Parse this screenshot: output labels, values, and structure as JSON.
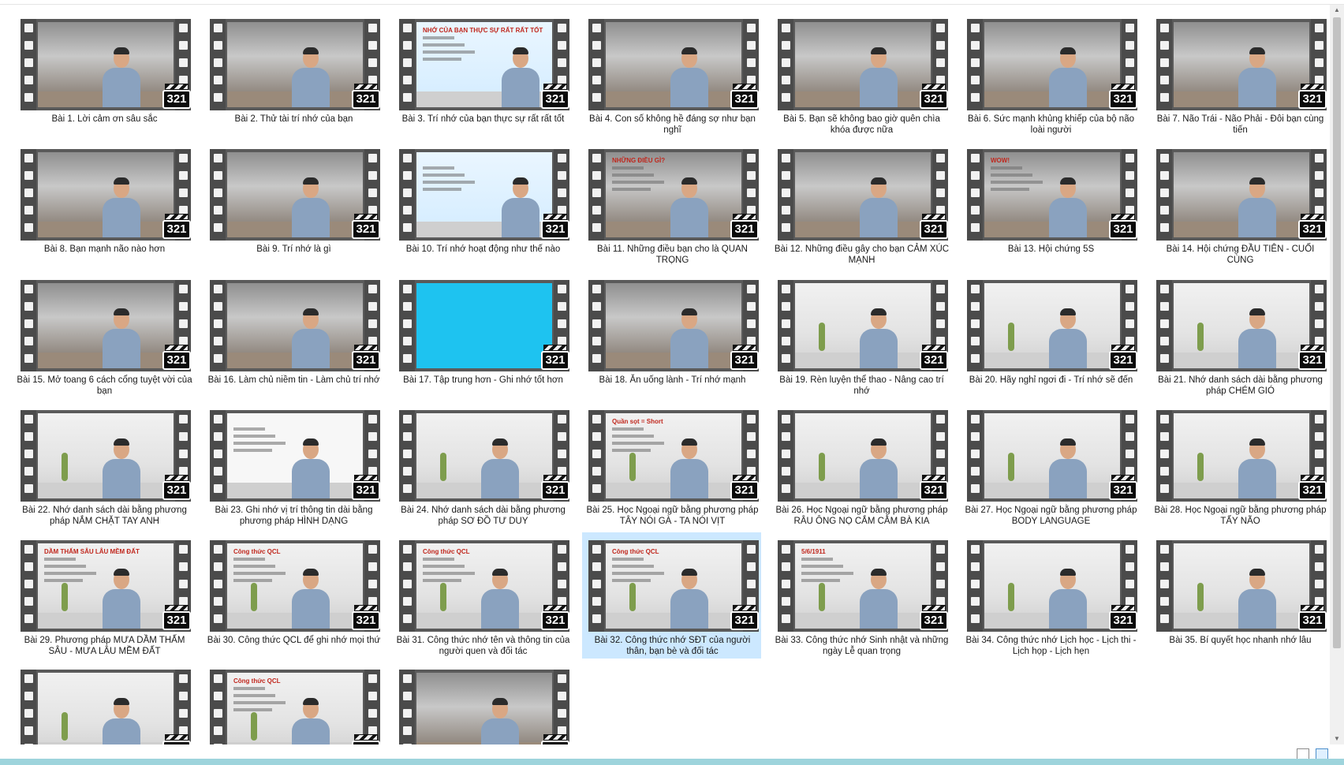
{
  "window": {
    "view_mode": "large-icons"
  },
  "badge_text": "321",
  "videos": [
    {
      "title": "Bài 1. Lời cảm ơn sâu sắc",
      "thumb": "room-dark"
    },
    {
      "title": "Bài 2. Thử tài trí nhớ của bạn",
      "thumb": "room-dark"
    },
    {
      "title": "Bài 3. Trí nhớ của bạn thực sự rất rất tốt",
      "thumb": "slide-light",
      "slide": "NHỚ CỦA BẠN THỰC SỰ RẤT RẤT TỐT"
    },
    {
      "title": "Bài 4. Con số không hề đáng sợ như bạn nghĩ",
      "thumb": "room-dark"
    },
    {
      "title": "Bài 5. Bạn sẽ không bao giờ quên chìa khóa được nữa",
      "thumb": "room-dark"
    },
    {
      "title": "Bài 6. Sức mạnh khủng khiếp của bộ não loài người",
      "thumb": "room-dark"
    },
    {
      "title": "Bài 7. Não Trái - Não Phải - Đôi bạn cùng tiến",
      "thumb": "room-dark"
    },
    {
      "title": "Bài 8. Bạn mạnh não nào hơn",
      "thumb": "room-dark"
    },
    {
      "title": "Bài 9. Trí nhớ là gì",
      "thumb": "room-dark"
    },
    {
      "title": "Bài 10. Trí nhớ hoạt động như thế nào",
      "thumb": "slide-light"
    },
    {
      "title": "Bài 11. Những điều bạn cho là QUAN TRỌNG",
      "thumb": "room-dark",
      "slide": "NHỮNG ĐIỀU GÌ?"
    },
    {
      "title": "Bài 12. Những điều gây cho bạn CẢM XÚC MẠNH",
      "thumb": "room-dark"
    },
    {
      "title": "Bài 13. Hội chứng 5S",
      "thumb": "room-dark",
      "slide": "WOW!"
    },
    {
      "title": "Bài 14. Hội chứng ĐẦU TIÊN - CUỐI CÙNG",
      "thumb": "room-dark"
    },
    {
      "title": "Bài 15. Mở toang 6 cách cổng tuyệt vời của bạn",
      "thumb": "room-dark"
    },
    {
      "title": "Bài 16. Làm chủ niềm tin - Làm chủ trí nhớ",
      "thumb": "room-dark"
    },
    {
      "title": "Bài 17. Tập trung hơn - Ghi nhớ tốt hơn",
      "thumb": "slide-cyan"
    },
    {
      "title": "Bài 18. Ăn uống lành - Trí nhớ mạnh",
      "thumb": "room-dark"
    },
    {
      "title": "Bài 19. Rèn luyện thể thao - Nâng cao trí nhớ",
      "thumb": "room-white"
    },
    {
      "title": "Bài 20. Hãy nghỉ ngơi đi - Trí nhớ sẽ đến",
      "thumb": "room-white"
    },
    {
      "title": "Bài 21. Nhớ danh sách dài bằng phương pháp CHÉM GIÓ",
      "thumb": "room-white"
    },
    {
      "title": "Bài 22. Nhớ danh sách dài bằng phương pháp NẮM CHẶT TAY ANH",
      "thumb": "room-white"
    },
    {
      "title": "Bài 23. Ghi nhớ vị trí thông tin dài bằng phương pháp HÌNH DẠNG",
      "thumb": "slide-white"
    },
    {
      "title": "Bài 24. Nhớ danh sách dài bằng phương pháp SƠ ĐỒ TƯ DUY",
      "thumb": "room-white"
    },
    {
      "title": "Bài 25. Học Ngoại ngữ bằng phương pháp TÂY NÓI GÀ - TA NÓI VỊT",
      "thumb": "room-white",
      "slide": "Quần sọt = Short"
    },
    {
      "title": "Bài 26. Học Ngoại ngữ bằng phương pháp RÂU ÔNG NỌ CẮM CẰM BÀ KIA",
      "thumb": "room-white"
    },
    {
      "title": "Bài 27. Học Ngoại ngữ bằng phương pháp BODY LANGUAGE",
      "thumb": "room-white"
    },
    {
      "title": "Bài 28. Học Ngoại ngữ bằng phương pháp TẨY NÃO",
      "thumb": "room-white"
    },
    {
      "title": "Bài 29. Phương pháp MƯA DẦM THẤM SÂU - MƯA LÂU MỀM ĐẤT",
      "thumb": "room-white",
      "slide": "DẦM THẤM SÂU LÂU MỀM ĐẤT"
    },
    {
      "title": "Bài 30. Công thức QCL để ghi nhớ mọi thứ",
      "thumb": "room-white",
      "slide": "Công thức QCL"
    },
    {
      "title": "Bài 31. Công thức nhớ tên và thông tin của người quen và đối tác",
      "thumb": "room-white",
      "slide": "Công thức QCL"
    },
    {
      "title": "Bài 32. Công thức nhớ SĐT của người thân, bạn bè và đối tác",
      "thumb": "room-white",
      "slide": "Công thức QCL",
      "selected": true
    },
    {
      "title": "Bài 33. Công thức nhớ Sinh nhật và những ngày Lễ quan trọng",
      "thumb": "room-white",
      "slide": "5/6/1911"
    },
    {
      "title": "Bài 34. Công thức nhớ Lịch học - Lịch thi - Lịch họp - Lịch hẹn",
      "thumb": "room-white"
    },
    {
      "title": "Bài 35. Bí quyết học nhanh nhớ lâu",
      "thumb": "room-white"
    },
    {
      "title": "",
      "thumb": "room-white"
    },
    {
      "title": "",
      "thumb": "room-white",
      "slide": "Công thức QCL"
    },
    {
      "title": "",
      "thumb": "room-dark"
    }
  ],
  "scrollbar": {
    "up": "▲",
    "down": "▼"
  },
  "colors": {
    "selection": "#cce8ff",
    "film": "#4b4b4b",
    "badge": "#0a0a0a"
  },
  "icons": {
    "view-details": "details-view-icon",
    "view-large": "large-icons-view-icon"
  }
}
